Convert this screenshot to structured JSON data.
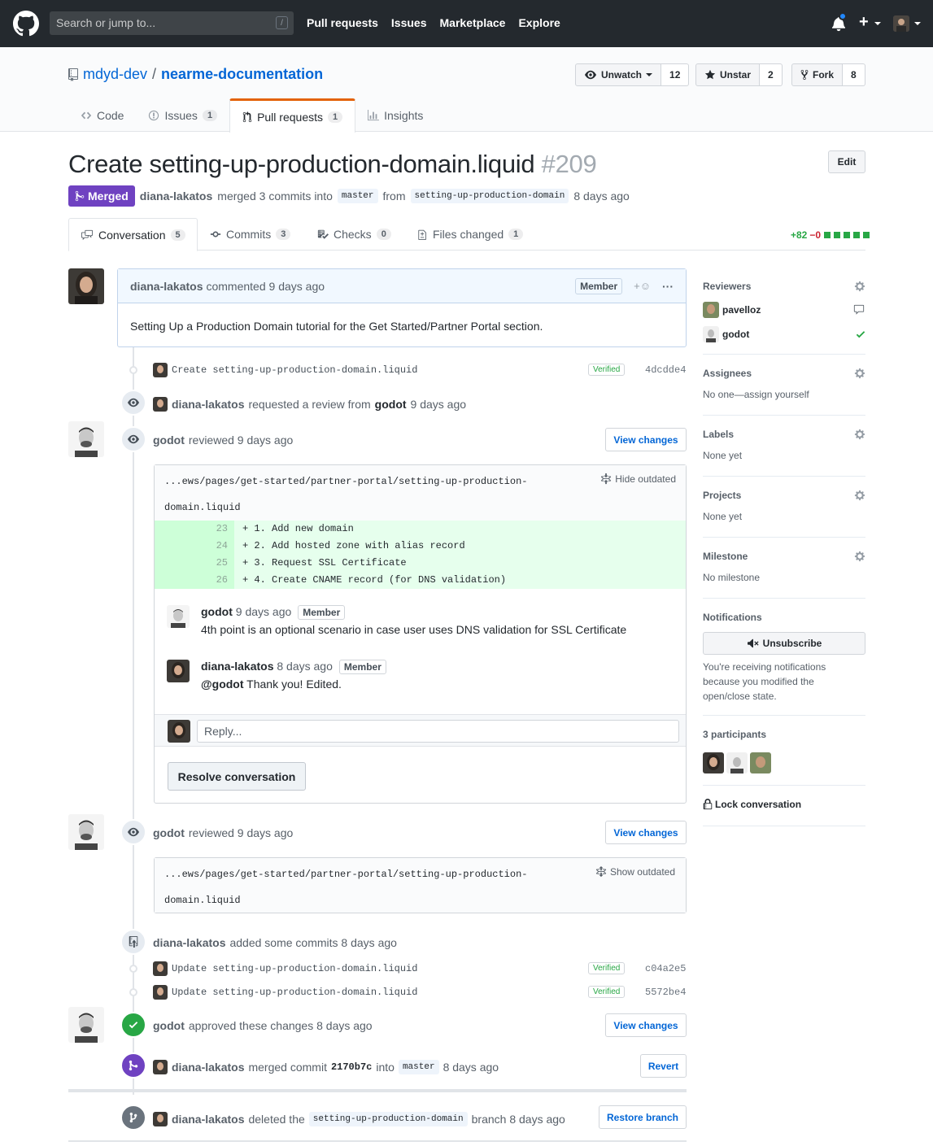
{
  "header": {
    "search_placeholder": "Search or jump to...",
    "search_shortcut": "/",
    "nav": [
      "Pull requests",
      "Issues",
      "Marketplace",
      "Explore"
    ]
  },
  "repo": {
    "owner": "mdyd-dev",
    "name": "nearme-documentation",
    "watch_label": "Unwatch",
    "watch_count": "12",
    "star_label": "Unstar",
    "star_count": "2",
    "fork_label": "Fork",
    "fork_count": "8",
    "tabs": [
      {
        "label": "Code",
        "count": ""
      },
      {
        "label": "Issues",
        "count": "1"
      },
      {
        "label": "Pull requests",
        "count": "1"
      },
      {
        "label": "Insights",
        "count": ""
      }
    ]
  },
  "pr": {
    "title": "Create setting-up-production-domain.liquid",
    "number": "#209",
    "edit_label": "Edit",
    "state": "Merged",
    "author": "diana-lakatos",
    "merged_text": "merged 3 commits into",
    "base": "master",
    "from_text": "from",
    "head": "setting-up-production-domain",
    "when": "8 days ago",
    "tabs": [
      {
        "label": "Conversation",
        "count": "5"
      },
      {
        "label": "Commits",
        "count": "3"
      },
      {
        "label": "Checks",
        "count": "0"
      },
      {
        "label": "Files changed",
        "count": "1"
      }
    ],
    "additions": "+82",
    "deletions": "−0"
  },
  "timeline": {
    "first_comment": {
      "author": "diana-lakatos",
      "action": "commented 9 days ago",
      "role": "Member",
      "body": "Setting Up a Production Domain tutorial for the Get Started/Partner Portal section."
    },
    "commit1": {
      "msg": "Create setting-up-production-domain.liquid",
      "verified": "Verified",
      "sha": "4dcdde4"
    },
    "review_request": {
      "author": "diana-lakatos",
      "text": "requested a review from",
      "reviewer": "godot",
      "when": "9 days ago"
    },
    "review1": {
      "author": "godot",
      "text": "reviewed 9 days ago",
      "view_changes": "View changes",
      "file_path": "...ews/pages/get-started/partner-portal/setting-up-production-",
      "file_path2": "domain.liquid",
      "toggle": "Hide outdated",
      "lines": [
        {
          "n": "23",
          "code": "+ 1. Add new domain"
        },
        {
          "n": "24",
          "code": "+ 2. Add hosted zone with alias record"
        },
        {
          "n": "25",
          "code": "+ 3. Request SSL Certificate"
        },
        {
          "n": "26",
          "code": "+ 4. Create CNAME record (for DNS validation)"
        }
      ],
      "c1_author": "godot",
      "c1_when": "9 days ago",
      "c1_role": "Member",
      "c1_body": "4th point is an optional scenario in case user uses DNS validation for SSL Certificate",
      "c2_author": "diana-lakatos",
      "c2_when": "8 days ago",
      "c2_role": "Member",
      "c2_mention": "@godot",
      "c2_body": " Thank you! Edited.",
      "reply_placeholder": "Reply...",
      "resolve": "Resolve conversation"
    },
    "review2": {
      "author": "godot",
      "text": "reviewed 9 days ago",
      "view_changes": "View changes",
      "file_path": "...ews/pages/get-started/partner-portal/setting-up-production-",
      "file_path2": "domain.liquid",
      "toggle": "Show outdated"
    },
    "added_commits": {
      "author": "diana-lakatos",
      "text": "added some commits 8 days ago"
    },
    "commit2": {
      "msg": "Update setting-up-production-domain.liquid",
      "verified": "Verified",
      "sha": "c04a2e5"
    },
    "commit3": {
      "msg": "Update setting-up-production-domain.liquid",
      "verified": "Verified",
      "sha": "5572be4"
    },
    "approved": {
      "author": "godot",
      "text": "approved these changes 8 days ago",
      "view_changes": "View changes"
    },
    "merged": {
      "author": "diana-lakatos",
      "text": "merged commit",
      "sha": "2170b7c",
      "into": "into",
      "base": "master",
      "when": "8 days ago",
      "revert": "Revert"
    },
    "deleted": {
      "author": "diana-lakatos",
      "text": "deleted the",
      "branch": "setting-up-production-domain",
      "suffix": "branch 8 days ago",
      "restore": "Restore branch"
    }
  },
  "sidebar": {
    "reviewers_label": "Reviewers",
    "reviewers": [
      "pavelloz",
      "godot"
    ],
    "assignees_label": "Assignees",
    "assignees_value": "No one—assign yourself",
    "labels_label": "Labels",
    "labels_value": "None yet",
    "projects_label": "Projects",
    "projects_value": "None yet",
    "milestone_label": "Milestone",
    "milestone_value": "No milestone",
    "notifications_label": "Notifications",
    "unsubscribe": "Unsubscribe",
    "notif_text": "You're receiving notifications because you modified the open/close state.",
    "participants_label": "3 participants",
    "lock": "Lock conversation"
  },
  "colors": {
    "merged": "#6f42c1",
    "approved": "#28a745",
    "link": "#0366d6"
  }
}
